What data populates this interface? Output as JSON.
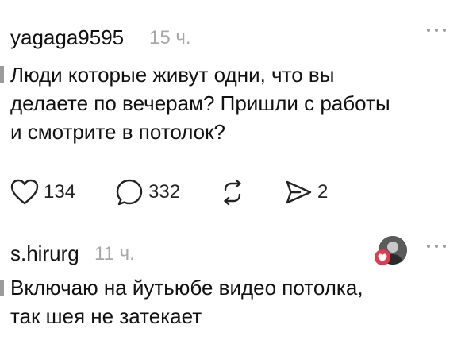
{
  "posts": [
    {
      "username": "yagaga9595",
      "time": "15 ч.",
      "text_lines": [
        "Люди которые живут одни, что вы",
        "делаете по вечерам? Пришли с работы",
        "и смотрите в потолок?"
      ],
      "likes": "134",
      "comments": "332",
      "shares": "2"
    },
    {
      "username": "s.hirurg",
      "time": "11 ч.",
      "text_lines": [
        "Включаю на йутьюбе видео потолка,",
        "так шея не затекает"
      ]
    }
  ],
  "icons": {
    "more": "more-horizontal-icon",
    "like": "heart-outline-icon",
    "comment": "comment-bubble-icon",
    "repost": "repost-icon",
    "share": "send-icon",
    "liked_badge": "heart-filled-icon"
  },
  "colors": {
    "text": "#111111",
    "time": "#a8a8a8",
    "icon": "#222222",
    "gutter": "#9b9b9b",
    "heart_badge": "#e23a4e"
  }
}
